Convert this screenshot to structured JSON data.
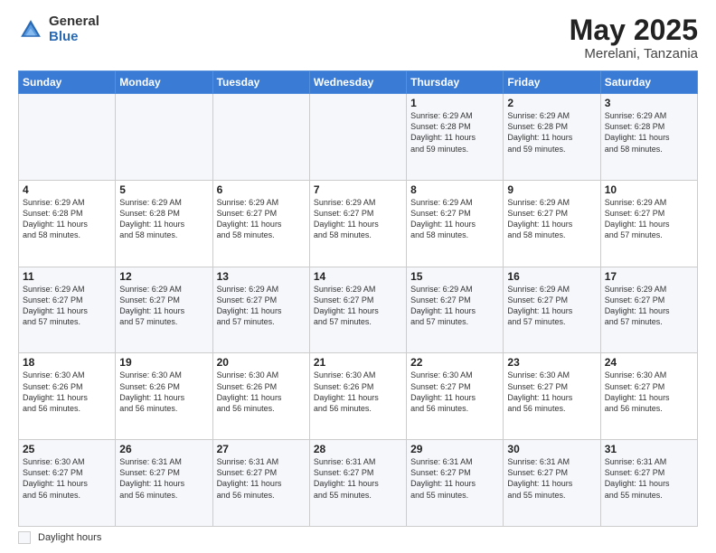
{
  "header": {
    "logo_general": "General",
    "logo_blue": "Blue",
    "month_title": "May 2025",
    "location": "Merelani, Tanzania"
  },
  "days_of_week": [
    "Sunday",
    "Monday",
    "Tuesday",
    "Wednesday",
    "Thursday",
    "Friday",
    "Saturday"
  ],
  "footer": {
    "daylight_label": "Daylight hours"
  },
  "weeks": [
    [
      {
        "day": "",
        "info": ""
      },
      {
        "day": "",
        "info": ""
      },
      {
        "day": "",
        "info": ""
      },
      {
        "day": "",
        "info": ""
      },
      {
        "day": "1",
        "info": "Sunrise: 6:29 AM\nSunset: 6:28 PM\nDaylight: 11 hours\nand 59 minutes."
      },
      {
        "day": "2",
        "info": "Sunrise: 6:29 AM\nSunset: 6:28 PM\nDaylight: 11 hours\nand 59 minutes."
      },
      {
        "day": "3",
        "info": "Sunrise: 6:29 AM\nSunset: 6:28 PM\nDaylight: 11 hours\nand 58 minutes."
      }
    ],
    [
      {
        "day": "4",
        "info": "Sunrise: 6:29 AM\nSunset: 6:28 PM\nDaylight: 11 hours\nand 58 minutes."
      },
      {
        "day": "5",
        "info": "Sunrise: 6:29 AM\nSunset: 6:28 PM\nDaylight: 11 hours\nand 58 minutes."
      },
      {
        "day": "6",
        "info": "Sunrise: 6:29 AM\nSunset: 6:27 PM\nDaylight: 11 hours\nand 58 minutes."
      },
      {
        "day": "7",
        "info": "Sunrise: 6:29 AM\nSunset: 6:27 PM\nDaylight: 11 hours\nand 58 minutes."
      },
      {
        "day": "8",
        "info": "Sunrise: 6:29 AM\nSunset: 6:27 PM\nDaylight: 11 hours\nand 58 minutes."
      },
      {
        "day": "9",
        "info": "Sunrise: 6:29 AM\nSunset: 6:27 PM\nDaylight: 11 hours\nand 58 minutes."
      },
      {
        "day": "10",
        "info": "Sunrise: 6:29 AM\nSunset: 6:27 PM\nDaylight: 11 hours\nand 57 minutes."
      }
    ],
    [
      {
        "day": "11",
        "info": "Sunrise: 6:29 AM\nSunset: 6:27 PM\nDaylight: 11 hours\nand 57 minutes."
      },
      {
        "day": "12",
        "info": "Sunrise: 6:29 AM\nSunset: 6:27 PM\nDaylight: 11 hours\nand 57 minutes."
      },
      {
        "day": "13",
        "info": "Sunrise: 6:29 AM\nSunset: 6:27 PM\nDaylight: 11 hours\nand 57 minutes."
      },
      {
        "day": "14",
        "info": "Sunrise: 6:29 AM\nSunset: 6:27 PM\nDaylight: 11 hours\nand 57 minutes."
      },
      {
        "day": "15",
        "info": "Sunrise: 6:29 AM\nSunset: 6:27 PM\nDaylight: 11 hours\nand 57 minutes."
      },
      {
        "day": "16",
        "info": "Sunrise: 6:29 AM\nSunset: 6:27 PM\nDaylight: 11 hours\nand 57 minutes."
      },
      {
        "day": "17",
        "info": "Sunrise: 6:29 AM\nSunset: 6:27 PM\nDaylight: 11 hours\nand 57 minutes."
      }
    ],
    [
      {
        "day": "18",
        "info": "Sunrise: 6:30 AM\nSunset: 6:26 PM\nDaylight: 11 hours\nand 56 minutes."
      },
      {
        "day": "19",
        "info": "Sunrise: 6:30 AM\nSunset: 6:26 PM\nDaylight: 11 hours\nand 56 minutes."
      },
      {
        "day": "20",
        "info": "Sunrise: 6:30 AM\nSunset: 6:26 PM\nDaylight: 11 hours\nand 56 minutes."
      },
      {
        "day": "21",
        "info": "Sunrise: 6:30 AM\nSunset: 6:26 PM\nDaylight: 11 hours\nand 56 minutes."
      },
      {
        "day": "22",
        "info": "Sunrise: 6:30 AM\nSunset: 6:27 PM\nDaylight: 11 hours\nand 56 minutes."
      },
      {
        "day": "23",
        "info": "Sunrise: 6:30 AM\nSunset: 6:27 PM\nDaylight: 11 hours\nand 56 minutes."
      },
      {
        "day": "24",
        "info": "Sunrise: 6:30 AM\nSunset: 6:27 PM\nDaylight: 11 hours\nand 56 minutes."
      }
    ],
    [
      {
        "day": "25",
        "info": "Sunrise: 6:30 AM\nSunset: 6:27 PM\nDaylight: 11 hours\nand 56 minutes."
      },
      {
        "day": "26",
        "info": "Sunrise: 6:31 AM\nSunset: 6:27 PM\nDaylight: 11 hours\nand 56 minutes."
      },
      {
        "day": "27",
        "info": "Sunrise: 6:31 AM\nSunset: 6:27 PM\nDaylight: 11 hours\nand 56 minutes."
      },
      {
        "day": "28",
        "info": "Sunrise: 6:31 AM\nSunset: 6:27 PM\nDaylight: 11 hours\nand 55 minutes."
      },
      {
        "day": "29",
        "info": "Sunrise: 6:31 AM\nSunset: 6:27 PM\nDaylight: 11 hours\nand 55 minutes."
      },
      {
        "day": "30",
        "info": "Sunrise: 6:31 AM\nSunset: 6:27 PM\nDaylight: 11 hours\nand 55 minutes."
      },
      {
        "day": "31",
        "info": "Sunrise: 6:31 AM\nSunset: 6:27 PM\nDaylight: 11 hours\nand 55 minutes."
      }
    ]
  ]
}
